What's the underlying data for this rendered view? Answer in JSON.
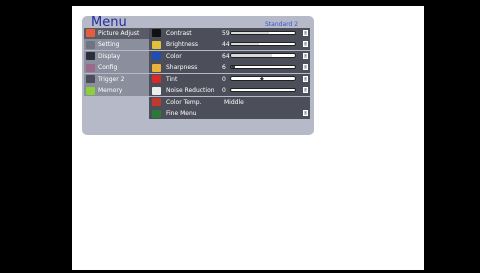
{
  "menu": {
    "title": "Menu",
    "preset": "Standard 2"
  },
  "sidebar": {
    "items": [
      {
        "label": "Picture Adjust",
        "icon": "picture-adjust-icon",
        "color": "#e95b3a",
        "selected": true
      },
      {
        "label": "Setting",
        "icon": "setting-icon",
        "color": "#6f7482",
        "selected": false
      },
      {
        "label": "Display",
        "icon": "display-icon",
        "color": "#2b2f3c",
        "selected": false
      },
      {
        "label": "Config",
        "icon": "config-icon",
        "color": "#9a6a8c",
        "selected": false
      },
      {
        "label": "Trigger 2",
        "icon": "trigger-icon",
        "color": "#4b4e5a",
        "selected": false
      },
      {
        "label": "Memory",
        "icon": "memory-icon",
        "color": "#8ccf3a",
        "selected": false
      }
    ]
  },
  "picture_adjust": {
    "rows": [
      {
        "label": "Contrast",
        "value": "59",
        "level": 0.59,
        "icon": "contrast-icon",
        "color": "#111"
      },
      {
        "label": "Brightness",
        "value": "44",
        "level": 0.44,
        "icon": "brightness-icon",
        "color": "#e0c03a"
      },
      {
        "label": "Color",
        "value": "64",
        "level": 0.64,
        "icon": "color-icon",
        "color": "#1f4fb5"
      },
      {
        "label": "Sharpness",
        "value": "6",
        "level": 0.06,
        "icon": "sharpness-icon",
        "color": "#e7b33b"
      },
      {
        "label": "Tint",
        "value": "0",
        "level": 0,
        "icon": "tint-icon",
        "color": "#d92a2a"
      },
      {
        "label": "Noise Reduction",
        "value": "0",
        "level": 0,
        "icon": "noise-reduction-icon",
        "color": "#eeeeee"
      },
      {
        "label": "Color Temp.",
        "value": "Middle",
        "icon": "color-temp-icon",
        "color": "#c0392b"
      },
      {
        "label": "Fine Menu",
        "icon": "fine-menu-icon",
        "color": "#2a7a38"
      }
    ]
  }
}
